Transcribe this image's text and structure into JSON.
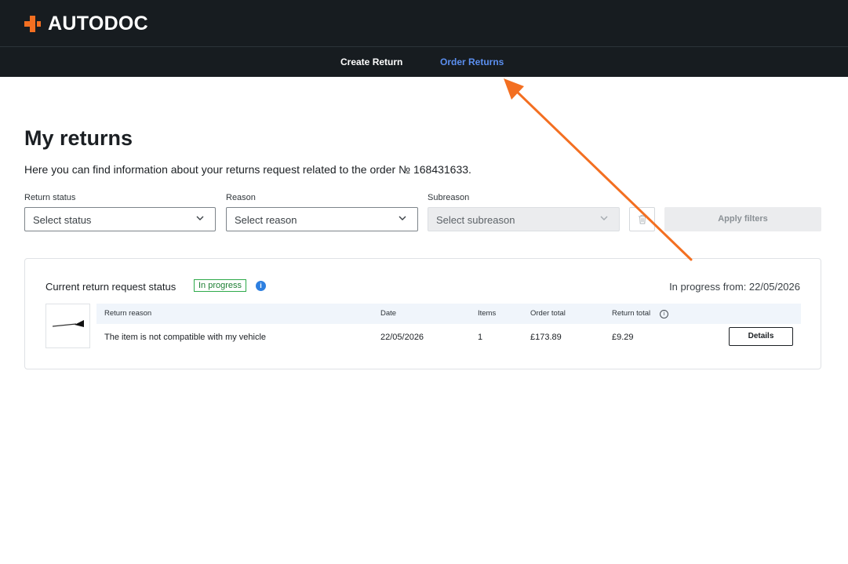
{
  "brand": {
    "logo_text": "AUTODOC",
    "accent_color": "#f36f21"
  },
  "nav": {
    "create_return": "Create Return",
    "order_returns": "Order Returns",
    "active_color": "#5b8ff0"
  },
  "page": {
    "title": "My returns",
    "intro": "Here you can find information about your returns request related to the order № 168431633."
  },
  "filters": {
    "status": {
      "label": "Return status",
      "placeholder": "Select status"
    },
    "reason": {
      "label": "Reason",
      "placeholder": "Select reason"
    },
    "subreason": {
      "label": "Subreason",
      "placeholder": "Select subreason",
      "disabled": true
    },
    "apply_label": "Apply filters",
    "clear_icon": "trash-icon"
  },
  "request": {
    "title": "Current return request status",
    "status_badge": "In progress",
    "status_color": "#2eaa4a",
    "progress_from": "In progress from: 22/05/2026",
    "columns": [
      "Return reason",
      "Date",
      "Items",
      "Order total",
      "Return total"
    ],
    "row": {
      "reason": "The item is not compatible with my vehicle",
      "date": "22/05/2026",
      "items": "1",
      "order_total": "£173.89",
      "return_total": "£9.29"
    },
    "details_label": "Details"
  },
  "annotation": {
    "arrow_color": "#f36f21"
  }
}
